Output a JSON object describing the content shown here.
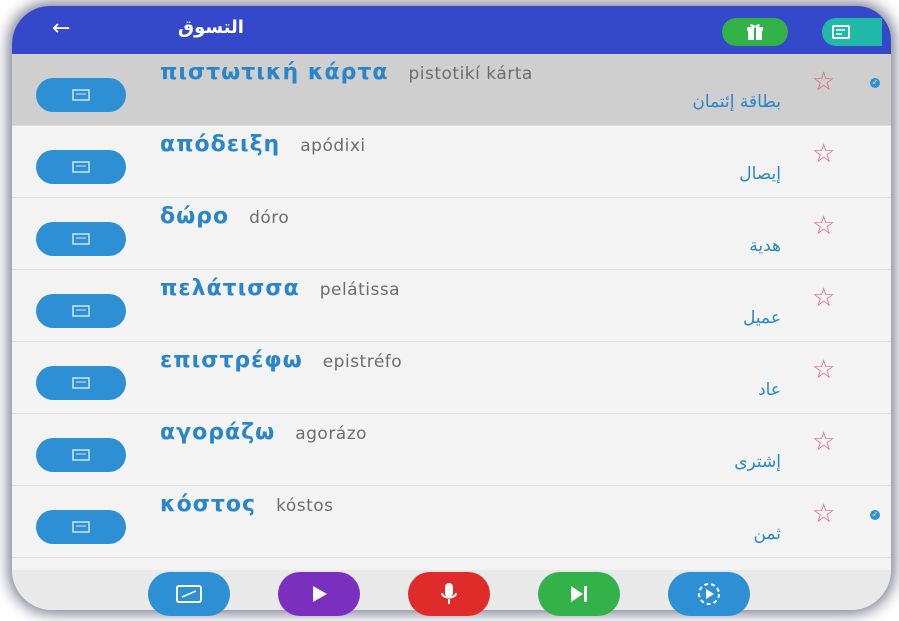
{
  "header": {
    "title": "التسوق",
    "back_glyph": "←"
  },
  "words": [
    {
      "greek": "πιστωτική κάρτα",
      "translit": "pistotikí kárta",
      "arabic": "بطاقة إئتمان",
      "selected": true,
      "checked": true
    },
    {
      "greek": "απόδειξη",
      "translit": "apódixi",
      "arabic": "إيصال",
      "selected": false,
      "checked": false
    },
    {
      "greek": "δώρο",
      "translit": "dóro",
      "arabic": "هدية",
      "selected": false,
      "checked": false
    },
    {
      "greek": "πελάτισσα",
      "translit": "pelátissa",
      "arabic": "عميل",
      "selected": false,
      "checked": false
    },
    {
      "greek": "επιστρέφω",
      "translit": "epistréfo",
      "arabic": "عاد",
      "selected": false,
      "checked": false
    },
    {
      "greek": "αγοράζω",
      "translit": "agorázo",
      "arabic": "إشترى",
      "selected": false,
      "checked": false
    },
    {
      "greek": "κόστος",
      "translit": "kóstos",
      "arabic": "ثمن",
      "selected": false,
      "checked": true
    }
  ],
  "icons": {
    "star": "☆",
    "check": "✓"
  },
  "colors": {
    "header": "#3448c9",
    "accent_blue": "#2d8fd4",
    "star_pink": "#e0607d",
    "play_purple": "#7a2fbf",
    "mic_red": "#e02b2b",
    "next_green": "#34b24a",
    "replay_blue": "#2d8fd4"
  },
  "toolbar": [
    "card-icon",
    "play-icon",
    "microphone-icon",
    "skip-next-icon",
    "replay-icon"
  ]
}
